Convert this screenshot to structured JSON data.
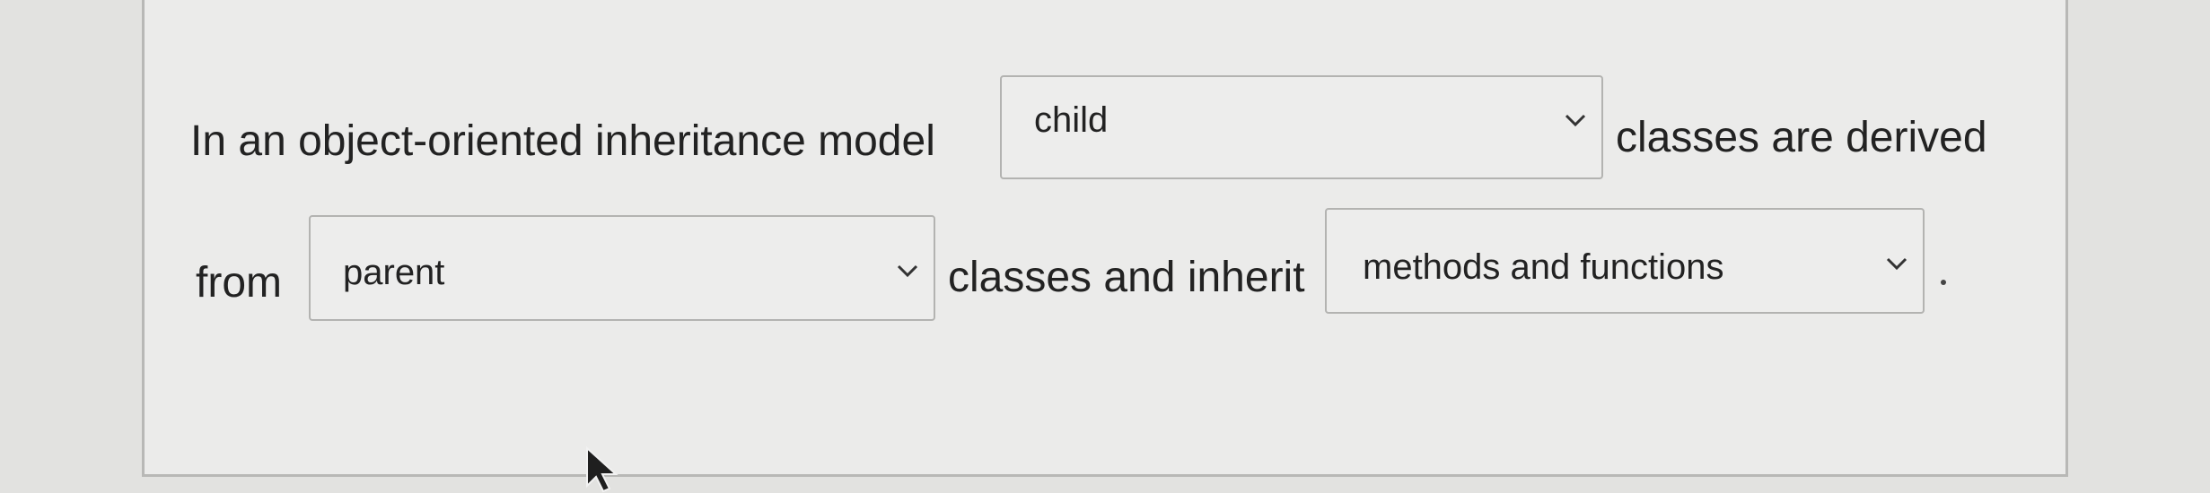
{
  "sentence": {
    "part1": "In an object-oriented inheritance model",
    "part2": "classes are derived",
    "part3": "from",
    "part4": "classes and inherit",
    "part5": "."
  },
  "dropdowns": [
    {
      "selected": "child",
      "icon": "chevron-down-icon"
    },
    {
      "selected": "parent",
      "icon": "chevron-down-icon"
    },
    {
      "selected": "methods and functions",
      "icon": "chevron-down-icon"
    }
  ],
  "colors": {
    "text": "#222222",
    "border": "#b3b3b1",
    "background": "#ebebea"
  }
}
